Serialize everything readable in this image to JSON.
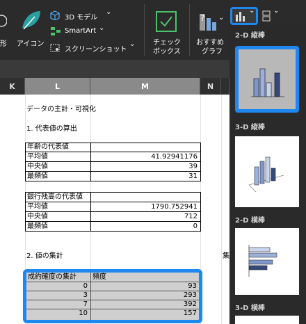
{
  "ribbon": {
    "left_labels": [
      "形",
      "アイコン"
    ],
    "model_3d": "3D モデル",
    "smartart": "SmartArt",
    "screenshot": "スクリーンショット",
    "checkbox_line1": "チェック",
    "checkbox_line2": "ボックス",
    "recommended_line1": "おすすめ",
    "recommended_line2": "グラフ",
    "dropdown_arrow": "⌄"
  },
  "columns": [
    "K",
    "L",
    "M",
    "N"
  ],
  "sheet": {
    "title": "データの主計・可視化",
    "section1": "1. 代表値の算出",
    "age_header": "年齢の代表値",
    "age_rows": [
      {
        "label": "平均値",
        "value": "41.92941176"
      },
      {
        "label": "中央値",
        "value": "39"
      },
      {
        "label": "最頻値",
        "value": "31"
      }
    ],
    "bank_header": "銀行残高の代表値",
    "bank_rows": [
      {
        "label": "平均値",
        "value": "1790.752941"
      },
      {
        "label": "中央値",
        "value": "712"
      },
      {
        "label": "最頻値",
        "value": "0"
      }
    ],
    "section2": "2. 値の集計",
    "cut_char": "集",
    "freq_header_left": "成約確度の集計",
    "freq_header_right": "頻度",
    "freq_rows": [
      {
        "key": "0",
        "value": "93"
      },
      {
        "key": "3",
        "value": "293"
      },
      {
        "key": "7",
        "value": "392"
      },
      {
        "key": "10",
        "value": "157"
      }
    ]
  },
  "chart_panel": {
    "sections": [
      "2-D 縦棒",
      "3-D 縦棒",
      "2-D 横棒",
      "3-D 横棒"
    ]
  },
  "colors": {
    "accent": "#1e88f0",
    "ribbon": "#2b2b2b",
    "highlight": "#cfcfcf"
  }
}
